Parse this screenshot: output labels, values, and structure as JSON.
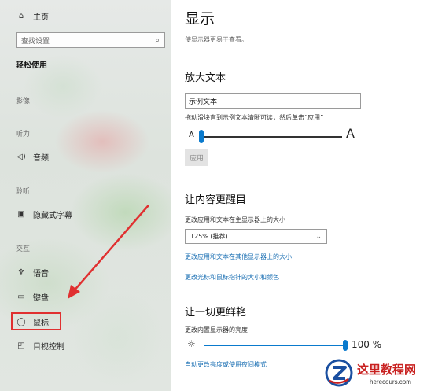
{
  "sidebar": {
    "home_label": "主页",
    "home_icon": "home-icon",
    "search_placeholder": "查找设置",
    "search_icon": "search-icon",
    "section_title": "轻松使用",
    "groups": {
      "vision": "影像",
      "hearing": "听力",
      "interaction_blur": "聆听",
      "interaction": "交互"
    },
    "items": {
      "audio": "音频",
      "captions": "隐藏式字幕",
      "speech": "语音",
      "keyboard": "键盘",
      "mouse": "鼠标",
      "eye_control": "目视控制"
    }
  },
  "main": {
    "title": "显示",
    "subtitle": "使显示器更易于查看。",
    "make_text_bigger": {
      "title": "放大文本",
      "sample_text": "示例文本",
      "hint": "拖动滑块直到示例文本清晰可读，然后单击“应用”",
      "small_a": "A",
      "big_a": "A",
      "slider_value": 0.0,
      "apply_label": "应用"
    },
    "make_everything_bigger": {
      "title": "让内容更醒目",
      "scale_label": "更改应用和文本在主显示器上的大小",
      "scale_value": "125% (推荐)",
      "link_other_displays": "更改应用和文本在其他显示器上的大小",
      "link_pointer": "更改光标和鼠标指针的大小和颜色"
    },
    "make_everything_brighter": {
      "title": "让一切更鲜艳",
      "brightness_label": "更改内置显示器的亮度",
      "brightness_value": "100 %",
      "brightness_fraction": 1.0,
      "link_night_light": "自动更改亮度或使用夜间模式"
    }
  },
  "watermark": {
    "cn": "这里教程网",
    "en": "herecours.com"
  },
  "colors": {
    "accent": "#0a7acd",
    "link": "#1a6fb3",
    "annotation": "#e03030",
    "watermark_red": "#c8201f"
  }
}
